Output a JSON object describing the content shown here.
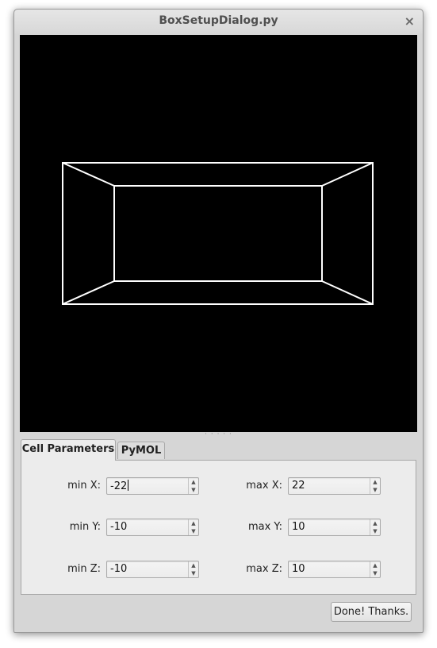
{
  "window": {
    "title": "BoxSetupDialog.py",
    "close_glyph": "×"
  },
  "splitter": {
    "grip": "· · · · ·"
  },
  "tabs": [
    {
      "label": "Cell Parameters",
      "active": true
    },
    {
      "label": "PyMOL",
      "active": false
    }
  ],
  "fields": {
    "min_x": {
      "label": "min X:",
      "value": "-22"
    },
    "max_x": {
      "label": "max X:",
      "value": "22"
    },
    "min_y": {
      "label": "min Y:",
      "value": "-10"
    },
    "max_y": {
      "label": "max Y:",
      "value": "10"
    },
    "min_z": {
      "label": "min Z:",
      "value": "-10"
    },
    "max_z": {
      "label": "max Z:",
      "value": "10"
    }
  },
  "spin_icons": {
    "up": "▲",
    "down": "▼"
  },
  "done_button": {
    "label": "Done! Thanks."
  },
  "colors": {
    "viewport_bg": "#000000",
    "wireframe": "#ffffff"
  }
}
